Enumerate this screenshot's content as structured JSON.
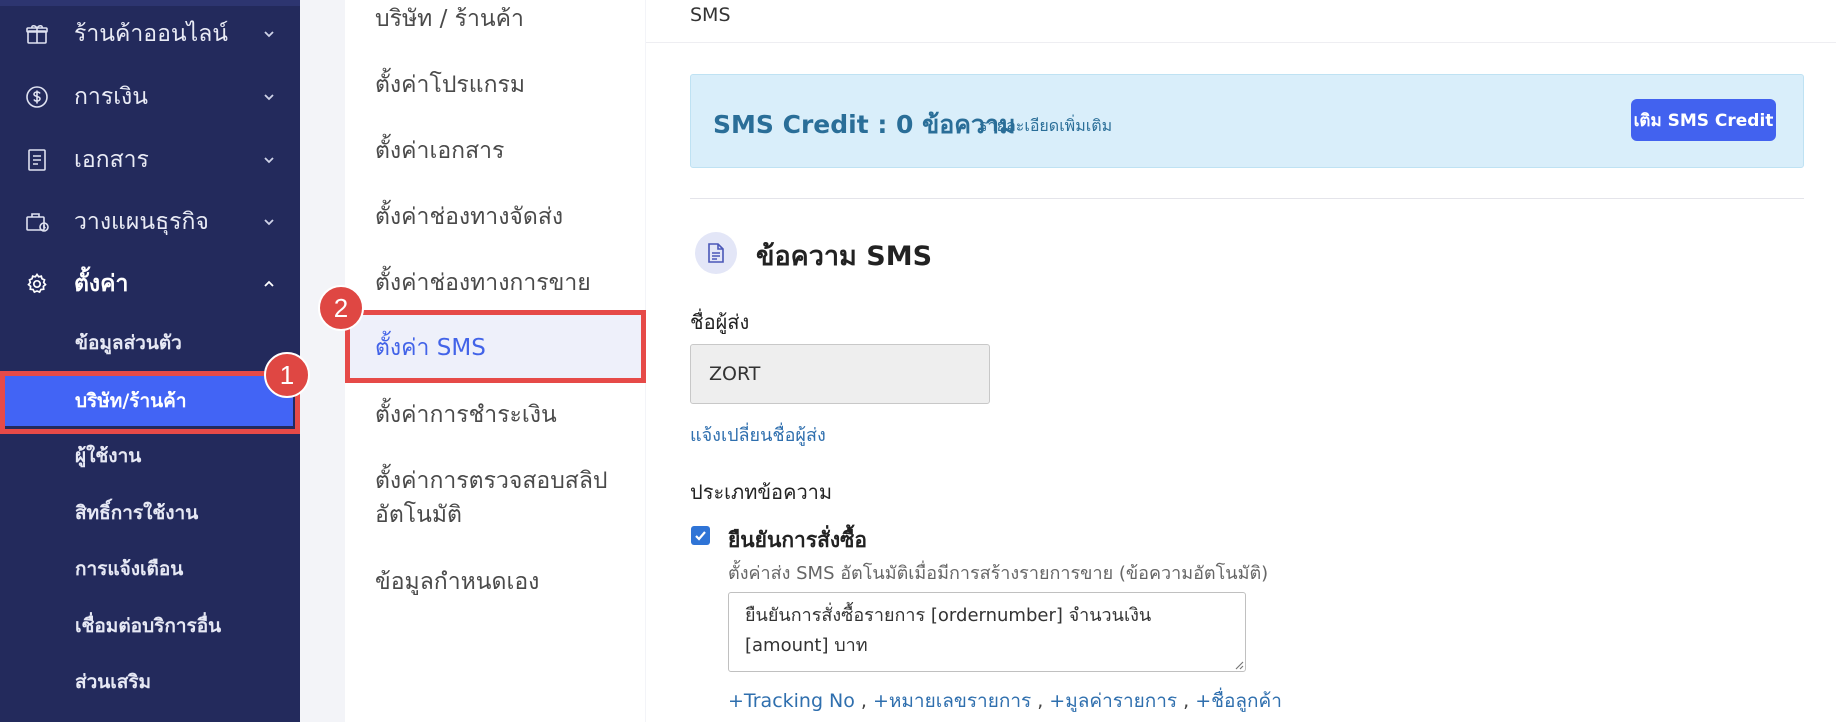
{
  "sidebar": {
    "items": [
      {
        "label": "ร้านค้าออนไลน์",
        "icon": "gift-icon"
      },
      {
        "label": "การเงิน",
        "icon": "dollar-coin-icon"
      },
      {
        "label": "เอกสาร",
        "icon": "document-icon"
      },
      {
        "label": "วางแผนธุรกิจ",
        "icon": "briefcase-icon"
      },
      {
        "label": "ตั้งค่า",
        "icon": "gear-icon",
        "active": true
      }
    ],
    "sub_items": [
      {
        "label": "ข้อมูลส่วนตัว"
      },
      {
        "label": "บริษัท/ร้านค้า",
        "active": true
      },
      {
        "label": "ผู้ใช้งาน"
      },
      {
        "label": "สิทธิ์การใช้งาน"
      },
      {
        "label": "การแจ้งเตือน"
      },
      {
        "label": "เชื่อมต่อบริการอื่น"
      },
      {
        "label": "ส่วนเสริม"
      }
    ]
  },
  "annotations": {
    "badge1": "1",
    "badge2": "2"
  },
  "settings_menu": {
    "items": [
      {
        "label": "บริษัท / ร้านค้า"
      },
      {
        "label": "ตั้งค่าโปรแกรม"
      },
      {
        "label": "ตั้งค่าเอกสาร"
      },
      {
        "label": "ตั้งค่าช่องทางจัดส่ง"
      },
      {
        "label": "ตั้งค่าช่องทางการขาย"
      },
      {
        "label": "ตั้งค่า SMS",
        "active": true
      },
      {
        "label": "ตั้งค่าการชำระเงิน"
      },
      {
        "label_line1": "ตั้งค่าการตรวจสอบสลิป",
        "label_line2": "อัตโนมัติ"
      },
      {
        "label": "ข้อมูลกำหนดเอง"
      }
    ]
  },
  "main": {
    "page_title": "SMS",
    "credit": {
      "text": "SMS Credit : 0 ข้อความ",
      "details_link": "รายละเอียดเพิ่มเติม",
      "button": "เติม SMS Credit"
    },
    "section_title": "ข้อความ SMS",
    "sender_label": "ชื่อผู้ส่ง",
    "sender_value": "ZORT",
    "change_sender_link": "แจ้งเปลี่ยนชื่อผู้ส่ง",
    "message_type_label": "ประเภทข้อความ",
    "order_confirm": {
      "checked": true,
      "label": "ยืนยันการสั่งซื้อ",
      "description": "ตั้งค่าส่ง SMS อัตโนมัติเมื่อมีการสร้างรายการขาย (ข้อความอัตโนมัติ)",
      "message": "ยืนยันการสั่งซื้อรายการ [ordernumber] จำนวนเงิน [amount] บาท"
    },
    "tags": [
      "+Tracking No",
      "+หมายเลขรายการ",
      "+มูลค่ารายการ",
      "+ชื่อลูกค้า"
    ],
    "tag_separator": ","
  },
  "colors": {
    "sidebar_bg": "#232a5c",
    "accent": "#4264f5",
    "highlight_red": "#e64a48",
    "credit_bg": "#d9eefa",
    "link": "#2f6fae"
  }
}
